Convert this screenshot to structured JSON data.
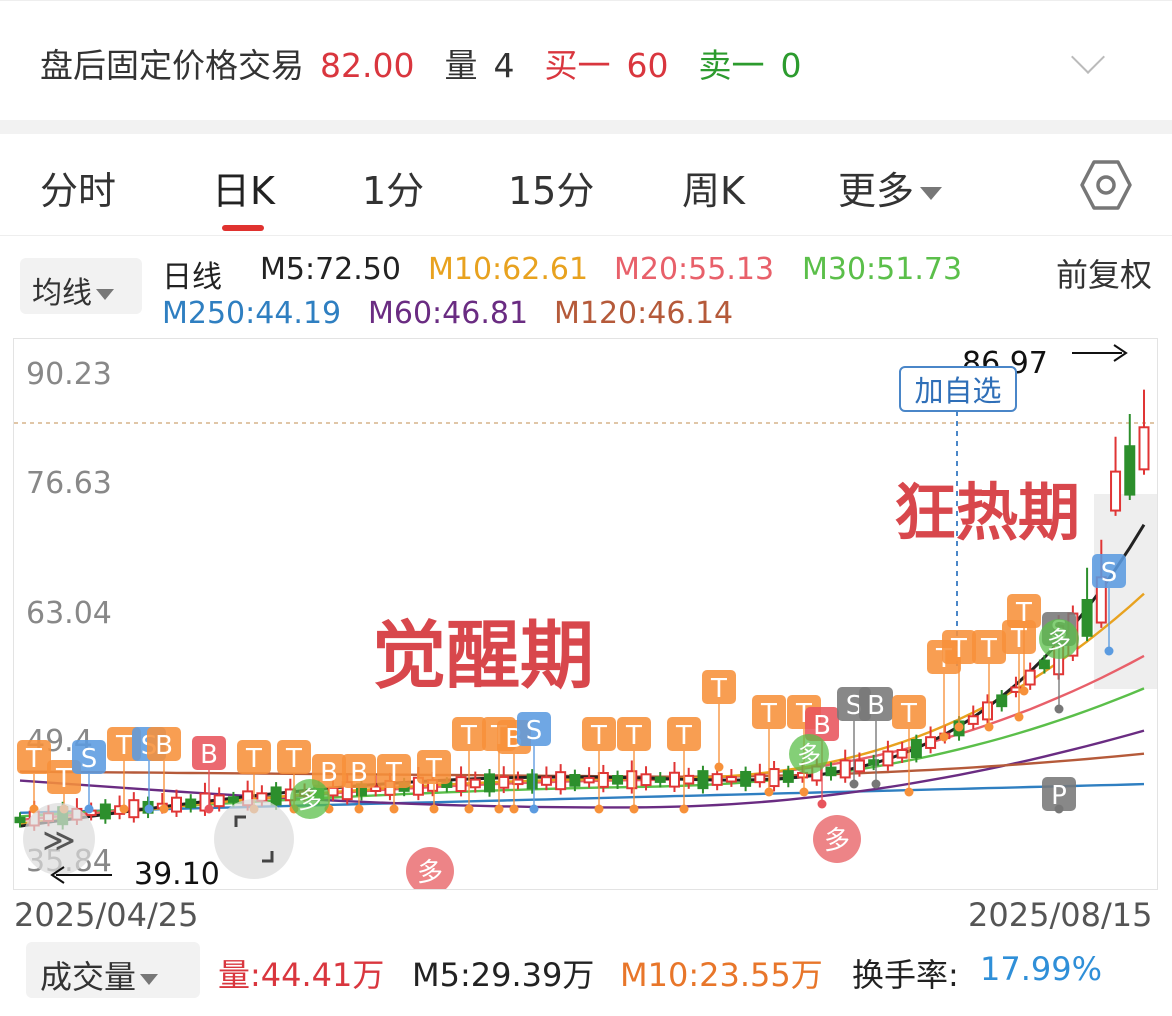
{
  "after_hours": {
    "label": "盘后固定价格交易",
    "price": "82.00",
    "volume_label": "量",
    "volume": "4",
    "bid_label": "买一",
    "bid": "60",
    "ask_label": "卖一",
    "ask": "0",
    "expand_icon": "chevron-down-icon"
  },
  "tabs": [
    {
      "label": "分时",
      "active": false
    },
    {
      "label": "日K",
      "active": true
    },
    {
      "label": "1分",
      "active": false
    },
    {
      "label": "15分",
      "active": false
    },
    {
      "label": "周K",
      "active": false
    },
    {
      "label": "更多",
      "active": false
    }
  ],
  "settings_icon": "hexagon-gear-icon",
  "ma_legend": {
    "selector": "均线",
    "period": "日线",
    "items": [
      {
        "text": "M5:72.50",
        "color": "#222222"
      },
      {
        "text": "M10:62.61",
        "color": "#e8a21f"
      },
      {
        "text": "M20:55.13",
        "color": "#e8606a"
      },
      {
        "text": "M30:51.73",
        "color": "#5bbf4a"
      },
      {
        "text": "M250:44.19",
        "color": "#2f7fc1"
      },
      {
        "text": "M60:46.81",
        "color": "#6a2c82"
      },
      {
        "text": "M120:46.14",
        "color": "#b55a3a"
      }
    ],
    "adjust": "前复权"
  },
  "chart_data": {
    "type": "candlestick",
    "y_ticks": [
      "90.23",
      "76.63",
      "63.04",
      "49.4",
      "35.84"
    ],
    "ylim": [
      35.84,
      90.23
    ],
    "high_label": "86.97",
    "low_label": "39.10",
    "annotations": [
      "觉醒期",
      "狂热期"
    ],
    "add_watchlist": "加自选",
    "markers": [
      "T",
      "S",
      "B",
      "多"
    ],
    "x_labels": [
      "2025/04/25",
      "2025/08/15"
    ],
    "colors": {
      "up": "#e03535",
      "down": "#2c8f2c",
      "marker_orange": "#f7913a"
    }
  },
  "volume_legend": {
    "selector": "成交量",
    "vol": "量:44.41万",
    "m5": "M5:29.39万",
    "m10": "M10:23.55万",
    "turnover_label": "换手率:",
    "turnover": "17.99%"
  }
}
